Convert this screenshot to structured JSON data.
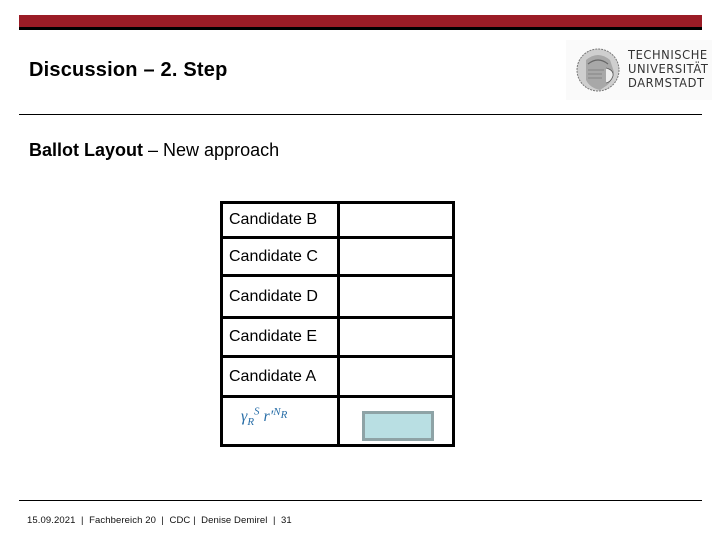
{
  "header": {
    "title": "Discussion – 2. Step",
    "brand_color": "#9b1c26",
    "logo": {
      "icon": "athena-seal-icon",
      "lines": [
        "TECHNISCHE",
        "UNIVERSITÄT",
        "DARMSTADT"
      ]
    }
  },
  "subtitle": {
    "bold": "Ballot Layout",
    "rest": " – New approach"
  },
  "ballot": {
    "candidates": [
      "Candidate B",
      "Candidate C",
      "Candidate D",
      "Candidate E",
      "Candidate A"
    ],
    "formula": {
      "base1": "γ",
      "sub1": "R",
      "sup1": "S",
      "base2": "r′",
      "sup2": "N",
      "sup2_sub": "R"
    },
    "code_box_color": "#b9dfe3"
  },
  "footer": {
    "text": "15.09.2021  |  Fachbereich 20  |  CDC |  Denise Demirel  |  31"
  }
}
